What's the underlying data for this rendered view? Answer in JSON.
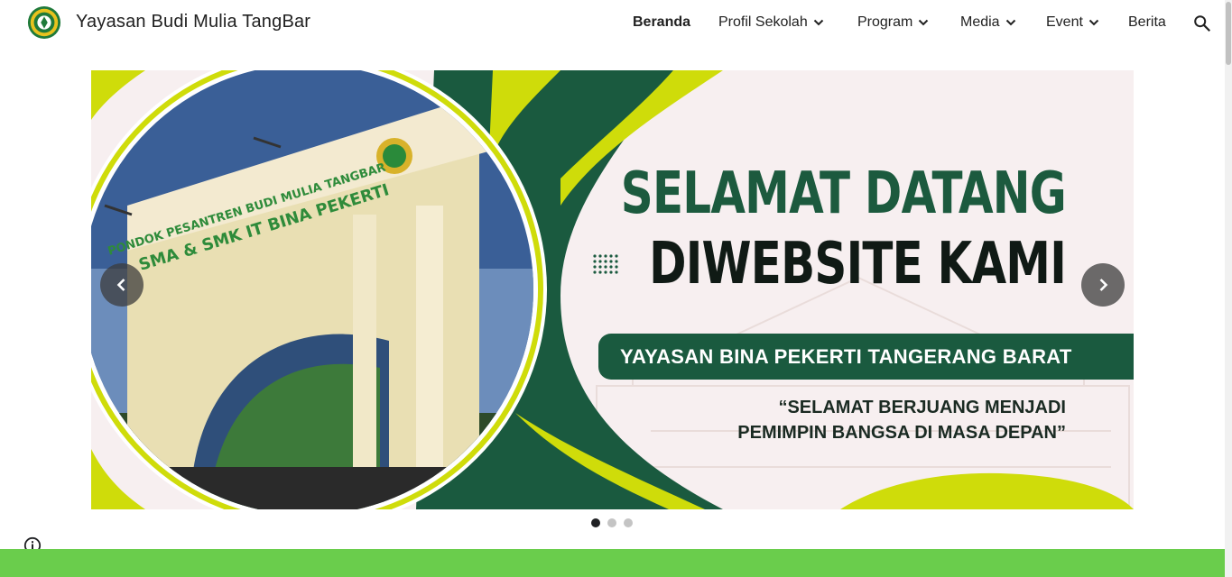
{
  "site": {
    "title": "Yayasan Budi Mulia TangBar"
  },
  "nav": [
    {
      "label": "Beranda",
      "active": true,
      "dropdown": false
    },
    {
      "label": "Profil Sekolah",
      "active": false,
      "dropdown": true
    },
    {
      "label": "Program",
      "active": false,
      "dropdown": true
    },
    {
      "label": "Media",
      "active": false,
      "dropdown": true
    },
    {
      "label": "Event",
      "active": false,
      "dropdown": true
    },
    {
      "label": "Berita",
      "active": false,
      "dropdown": false
    }
  ],
  "hero": {
    "welcome_line1": "SELAMAT DATANG",
    "welcome_line2": "DIWEBSITE KAMI",
    "banner": "YAYASAN BINA PEKERTI TANGERANG BARAT",
    "quote_line1": "“SELAMAT BERJUANG MENJADI",
    "quote_line2": "PEMIMPIN BANGSA DI MASA DEPAN”",
    "gate_sign_line1": "PONDOK PESANTREN BUDI MULIA TANGBAR",
    "gate_sign_line2": "SMA & SMK IT BINA PEKERTI"
  },
  "carousel": {
    "slides": 3,
    "active_index": 0
  },
  "colors": {
    "dark_green": "#1a5a3f",
    "lime": "#cfdc0a",
    "footer_green": "#6acd4c"
  },
  "icons": [
    "logo",
    "chevron-down-icon",
    "search-icon",
    "chevron-left-icon",
    "chevron-right-icon",
    "info-icon"
  ]
}
